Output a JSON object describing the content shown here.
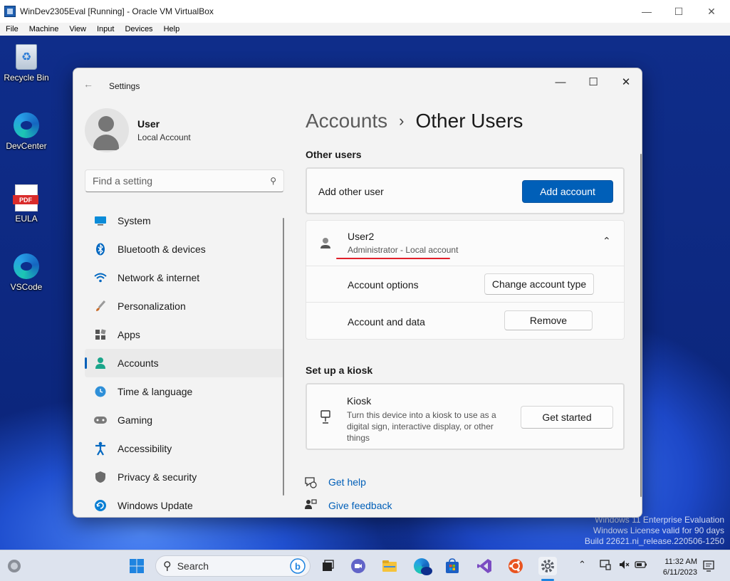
{
  "host": {
    "title": "WinDev2305Eval [Running] - Oracle VM VirtualBox",
    "menu": [
      "File",
      "Machine",
      "View",
      "Input",
      "Devices",
      "Help"
    ]
  },
  "desktop": {
    "icons": [
      {
        "label": "Recycle Bin",
        "icon": "recycle-bin-icon"
      },
      {
        "label": "DevCenter",
        "icon": "edge-icon"
      },
      {
        "label": "EULA",
        "icon": "pdf-icon",
        "badge": "PDF"
      },
      {
        "label": "VSCode",
        "icon": "edge-icon"
      }
    ],
    "watermark": [
      "Windows 11 Enterprise Evaluation",
      "Windows License valid for 90 days",
      "Build 22621.ni_release.220506-1250"
    ]
  },
  "settings": {
    "app_title": "Settings",
    "user": {
      "name": "User",
      "type": "Local Account"
    },
    "search_placeholder": "Find a setting",
    "nav": [
      {
        "label": "System",
        "icon": "monitor-icon",
        "color": "#0067c0"
      },
      {
        "label": "Bluetooth & devices",
        "icon": "bluetooth-icon",
        "color": "#0067c0"
      },
      {
        "label": "Network & internet",
        "icon": "wifi-icon",
        "color": "#0067c0"
      },
      {
        "label": "Personalization",
        "icon": "paintbrush-icon",
        "color": "#c86b2a"
      },
      {
        "label": "Apps",
        "icon": "apps-icon",
        "color": "#555555"
      },
      {
        "label": "Accounts",
        "icon": "person-icon",
        "color": "#1aa58a",
        "active": true
      },
      {
        "label": "Time & language",
        "icon": "globe-clock-icon",
        "color": "#0067c0"
      },
      {
        "label": "Gaming",
        "icon": "gamepad-icon",
        "color": "#6b6b6b"
      },
      {
        "label": "Accessibility",
        "icon": "accessibility-icon",
        "color": "#0067c0"
      },
      {
        "label": "Privacy & security",
        "icon": "shield-icon",
        "color": "#6b6b6b"
      },
      {
        "label": "Windows Update",
        "icon": "update-icon",
        "color": "#0067c0"
      }
    ],
    "breadcrumb": {
      "parent": "Accounts",
      "current": "Other Users"
    },
    "other_users": {
      "heading": "Other users",
      "add_label": "Add other user",
      "add_button": "Add account",
      "user": {
        "name": "User2",
        "role": "Administrator - Local account",
        "options_label": "Account options",
        "change_button": "Change account type",
        "data_label": "Account and data",
        "remove_button": "Remove"
      }
    },
    "kiosk": {
      "heading": "Set up a kiosk",
      "title": "Kiosk",
      "description": "Turn this device into a kiosk to use as a digital sign, interactive display, or other things",
      "button": "Get started"
    },
    "links": {
      "help": "Get help",
      "feedback": "Give feedback"
    }
  },
  "taskbar": {
    "search_label": "Search",
    "time": "11:32 AM",
    "date": "6/11/2023"
  },
  "colors": {
    "accent": "#005fb8",
    "annotation_underline": "#e0202a"
  }
}
